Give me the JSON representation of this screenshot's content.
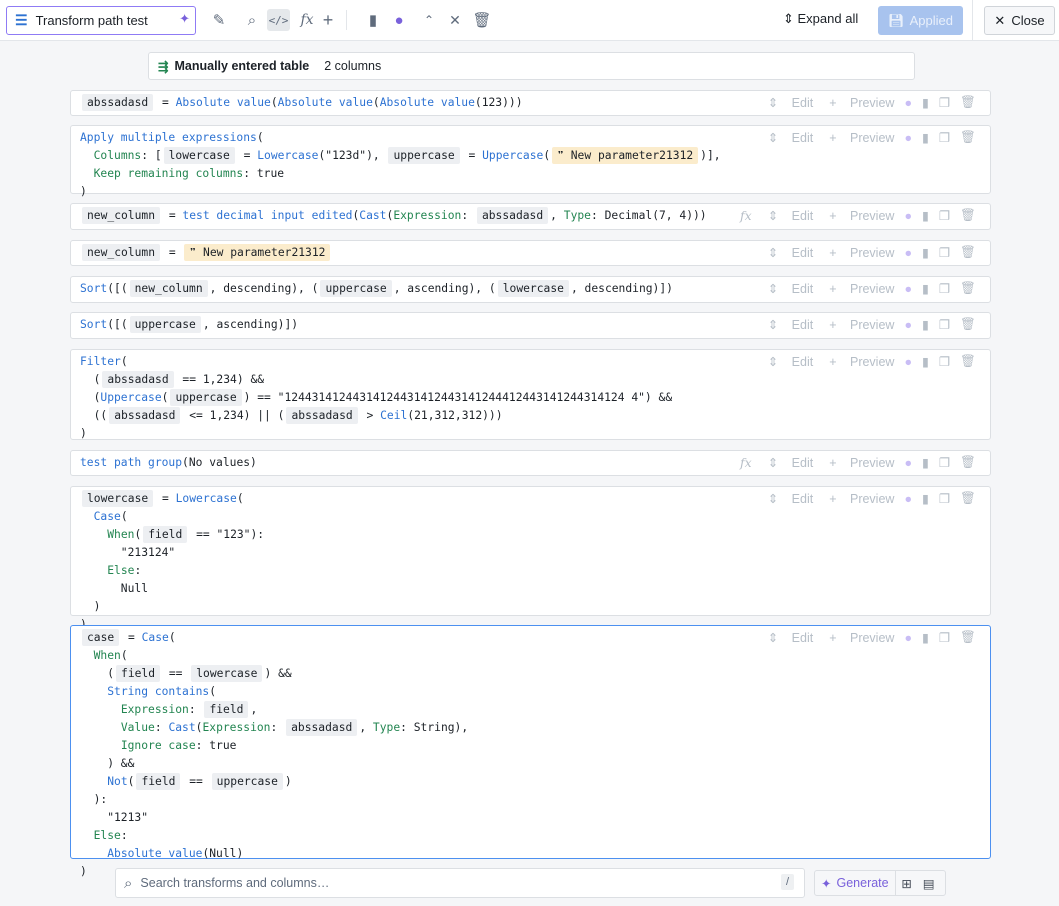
{
  "toolbar": {
    "title": "Transform path test",
    "expand_all": "Expand all",
    "applied": "Applied",
    "close": "Close",
    "icons": [
      "edit-icon",
      "search-preview-icon",
      "code-icon",
      "function-icon",
      "add-icon",
      "clipboard-icon",
      "lightbulb-icon",
      "expand-icon",
      "collapse-icon",
      "trash-icon"
    ]
  },
  "source": {
    "name": "Manually entered table",
    "columns": "2 columns"
  },
  "actions": {
    "edit": "Edit",
    "preview": "Preview"
  },
  "cards": [
    {
      "fx": false,
      "lines": [
        [
          [
            "abssadasd",
            "c"
          ],
          [
            " = ",
            "p"
          ],
          [
            "Absolute value",
            "f"
          ],
          [
            "(",
            "p"
          ],
          [
            "Absolute value",
            "f"
          ],
          [
            "(",
            "p"
          ],
          [
            "Absolute value",
            "f"
          ],
          [
            "(123)))",
            "p"
          ]
        ]
      ]
    },
    {
      "fx": false,
      "lines": [
        [
          [
            "Apply multiple expressions",
            "f"
          ],
          [
            "(",
            "p"
          ]
        ],
        [
          [
            "  ",
            "p"
          ],
          [
            "Columns",
            "k"
          ],
          [
            ": [",
            "p"
          ],
          [
            "lowercase",
            "c"
          ],
          [
            " = ",
            "p"
          ],
          [
            "Lowercase",
            "f"
          ],
          [
            "(\"123d\"), ",
            "p"
          ],
          [
            "uppercase",
            "c"
          ],
          [
            " = ",
            "p"
          ],
          [
            "Uppercase",
            "f"
          ],
          [
            "(",
            "p"
          ],
          [
            "❞ New parameter21312",
            "s"
          ],
          [
            ")],",
            "p"
          ]
        ],
        [
          [
            "  ",
            "p"
          ],
          [
            "Keep remaining columns",
            "k"
          ],
          [
            ": true",
            "p"
          ]
        ],
        [
          [
            ")",
            "p"
          ]
        ]
      ]
    },
    {
      "fx": true,
      "lines": [
        [
          [
            "new_column",
            "c"
          ],
          [
            " = ",
            "p"
          ],
          [
            "test decimal input edited",
            "f"
          ],
          [
            "(",
            "p"
          ],
          [
            "Cast",
            "f"
          ],
          [
            "(",
            "p"
          ],
          [
            "Expression",
            "k"
          ],
          [
            ": ",
            "p"
          ],
          [
            "abssadasd",
            "c"
          ],
          [
            ", ",
            "p"
          ],
          [
            "Type",
            "k"
          ],
          [
            ": Decimal(7, 4)))",
            "p"
          ]
        ]
      ]
    },
    {
      "fx": false,
      "lines": [
        [
          [
            "new_column",
            "c"
          ],
          [
            " = ",
            "p"
          ],
          [
            "❞ New parameter21312",
            "s"
          ]
        ]
      ]
    },
    {
      "fx": false,
      "lines": [
        [
          [
            "Sort",
            "f"
          ],
          [
            "([(",
            "p"
          ],
          [
            "new_column",
            "c"
          ],
          [
            ", descending), (",
            "p"
          ],
          [
            "uppercase",
            "c"
          ],
          [
            ", ascending), (",
            "p"
          ],
          [
            "lowercase",
            "c"
          ],
          [
            ", descending)])",
            "p"
          ]
        ]
      ]
    },
    {
      "fx": false,
      "lines": [
        [
          [
            "Sort",
            "f"
          ],
          [
            "([(",
            "p"
          ],
          [
            "uppercase",
            "c"
          ],
          [
            ", ascending)])",
            "p"
          ]
        ]
      ]
    },
    {
      "fx": false,
      "lines": [
        [
          [
            "Filter",
            "f"
          ],
          [
            "(",
            "p"
          ]
        ],
        [
          [
            "  (",
            "p"
          ],
          [
            "abssadasd",
            "c"
          ],
          [
            " == 1,234) &&",
            "p"
          ]
        ],
        [
          [
            "  (",
            "p"
          ],
          [
            "Uppercase",
            "f"
          ],
          [
            "(",
            "p"
          ],
          [
            "uppercase",
            "c"
          ],
          [
            ") == \"12443141244314124431412443141244412443141244314124 4\") &&",
            "p"
          ]
        ],
        [
          [
            "  ((",
            "p"
          ],
          [
            "abssadasd",
            "c"
          ],
          [
            " <= 1,234) || (",
            "p"
          ],
          [
            "abssadasd",
            "c"
          ],
          [
            " > ",
            "p"
          ],
          [
            "Ceil",
            "f"
          ],
          [
            "(21,312,312)))",
            "p"
          ]
        ],
        [
          [
            ")",
            "p"
          ]
        ]
      ]
    },
    {
      "fx": true,
      "lines": [
        [
          [
            "test path group",
            "f"
          ],
          [
            "(No values)",
            "p"
          ]
        ]
      ]
    },
    {
      "fx": false,
      "lines": [
        [
          [
            "lowercase",
            "c"
          ],
          [
            " = ",
            "p"
          ],
          [
            "Lowercase",
            "f"
          ],
          [
            "(",
            "p"
          ]
        ],
        [
          [
            "  ",
            "p"
          ],
          [
            "Case",
            "f"
          ],
          [
            "(",
            "p"
          ]
        ],
        [
          [
            "    ",
            "p"
          ],
          [
            "When",
            "k"
          ],
          [
            "(",
            "p"
          ],
          [
            "field",
            "c"
          ],
          [
            " == \"123\"):",
            "p"
          ]
        ],
        [
          [
            "      \"213124\"",
            "p"
          ]
        ],
        [
          [
            "    ",
            "p"
          ],
          [
            "Else",
            "k"
          ],
          [
            ":",
            "p"
          ]
        ],
        [
          [
            "      Null",
            "p"
          ]
        ],
        [
          [
            "  )",
            "p"
          ]
        ],
        [
          [
            ")",
            "p"
          ]
        ]
      ]
    },
    {
      "fx": false,
      "sel": true,
      "lines": [
        [
          [
            "case",
            "c"
          ],
          [
            " = ",
            "p"
          ],
          [
            "Case",
            "f"
          ],
          [
            "(",
            "p"
          ]
        ],
        [
          [
            "  ",
            "p"
          ],
          [
            "When",
            "k"
          ],
          [
            "(",
            "p"
          ]
        ],
        [
          [
            "    (",
            "p"
          ],
          [
            "field",
            "c"
          ],
          [
            " == ",
            "p"
          ],
          [
            "lowercase",
            "c"
          ],
          [
            ") &&",
            "p"
          ]
        ],
        [
          [
            "    ",
            "p"
          ],
          [
            "String contains",
            "f"
          ],
          [
            "(",
            "p"
          ]
        ],
        [
          [
            "      ",
            "p"
          ],
          [
            "Expression",
            "k"
          ],
          [
            ": ",
            "p"
          ],
          [
            "field",
            "c"
          ],
          [
            ",",
            "p"
          ]
        ],
        [
          [
            "      ",
            "p"
          ],
          [
            "Value",
            "k"
          ],
          [
            ": ",
            "p"
          ],
          [
            "Cast",
            "f"
          ],
          [
            "(",
            "p"
          ],
          [
            "Expression",
            "k"
          ],
          [
            ": ",
            "p"
          ],
          [
            "abssadasd",
            "c"
          ],
          [
            ", ",
            "p"
          ],
          [
            "Type",
            "k"
          ],
          [
            ": String),",
            "p"
          ]
        ],
        [
          [
            "      ",
            "p"
          ],
          [
            "Ignore case",
            "k"
          ],
          [
            ": true",
            "p"
          ]
        ],
        [
          [
            "    ) &&",
            "p"
          ]
        ],
        [
          [
            "    ",
            "p"
          ],
          [
            "Not",
            "f"
          ],
          [
            "(",
            "p"
          ],
          [
            "field",
            "c"
          ],
          [
            " == ",
            "p"
          ],
          [
            "uppercase",
            "c"
          ],
          [
            ")",
            "p"
          ]
        ],
        [
          [
            "  ):",
            "p"
          ]
        ],
        [
          [
            "    \"1213\"",
            "p"
          ]
        ],
        [
          [
            "  ",
            "p"
          ],
          [
            "Else",
            "k"
          ],
          [
            ":",
            "p"
          ]
        ],
        [
          [
            "    ",
            "p"
          ],
          [
            "Absolute value",
            "f"
          ],
          [
            "(Null)",
            "p"
          ]
        ],
        [
          [
            ")",
            "p"
          ]
        ]
      ]
    }
  ],
  "footer": {
    "search_placeholder": "Search transforms and columns…",
    "shortcut": "/",
    "generate": "Generate"
  }
}
